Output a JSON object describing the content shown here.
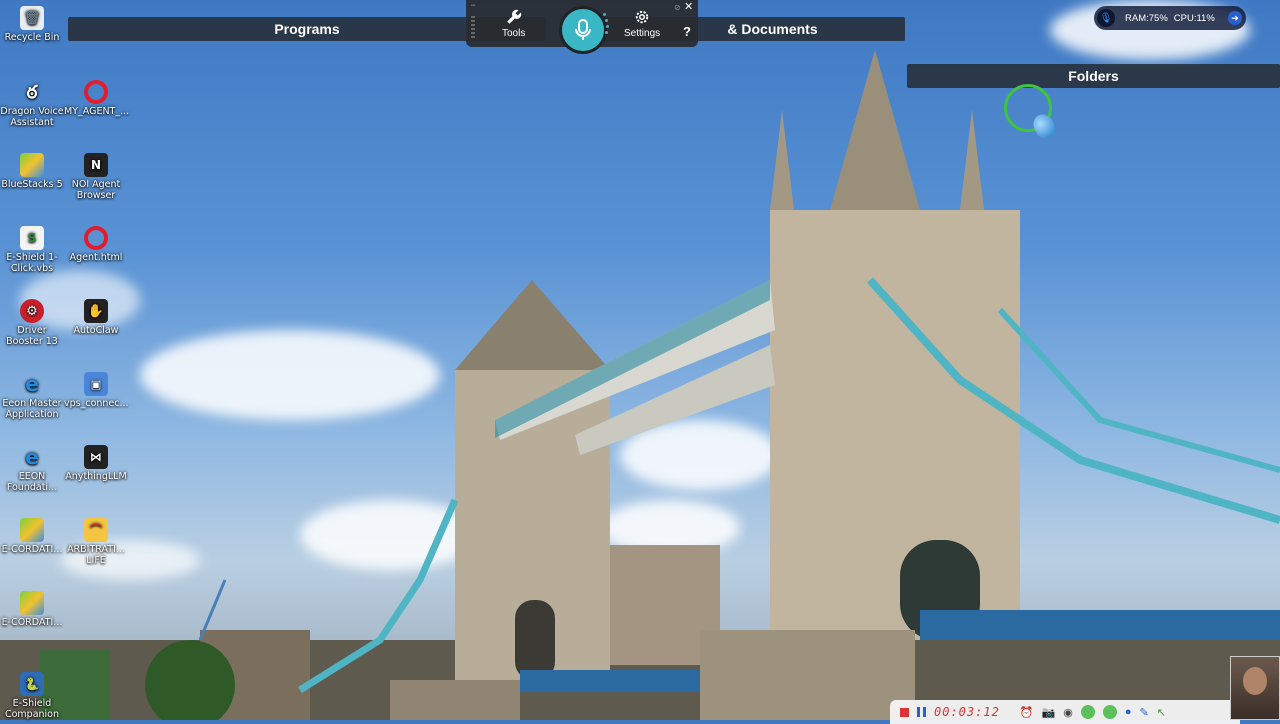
{
  "desktop": {
    "icons": [
      {
        "label": "Recycle Bin"
      },
      {
        "label": "Dragon Voice Assistant"
      },
      {
        "label": "MY_AGENT_..."
      },
      {
        "label": "BlueStacks 5"
      },
      {
        "label": "NOI Agent Browser"
      },
      {
        "label": "E-Shield 1-Click.vbs"
      },
      {
        "label": "Agent.html"
      },
      {
        "label": "Driver Booster 13"
      },
      {
        "label": "AutoClaw"
      },
      {
        "label": "Eeon Master Application"
      },
      {
        "label": "vps_connec..."
      },
      {
        "label": "EEON Foundati..."
      },
      {
        "label": "AnythingLLM"
      },
      {
        "label": "E-CORDATI..."
      },
      {
        "label": "ARBITRATI... LIFE"
      },
      {
        "label": "E-CORDATI..."
      },
      {
        "label": "E-Shield Companion"
      }
    ]
  },
  "bars": {
    "programs": "Programs",
    "documents": "& Documents",
    "folders": "Folders"
  },
  "toolbar": {
    "tools_label": "Tools",
    "settings_label": "Settings",
    "help_label": "?",
    "close_label": "✕",
    "minimize_label": "−"
  },
  "monitor": {
    "ram": "RAM:75%",
    "cpu": "CPU:11%"
  },
  "recorder": {
    "timer": "00:03:12"
  },
  "colors": {
    "accent_teal": "#3ab7c4",
    "bar_dark": "#23282d",
    "record_red": "#d33"
  }
}
